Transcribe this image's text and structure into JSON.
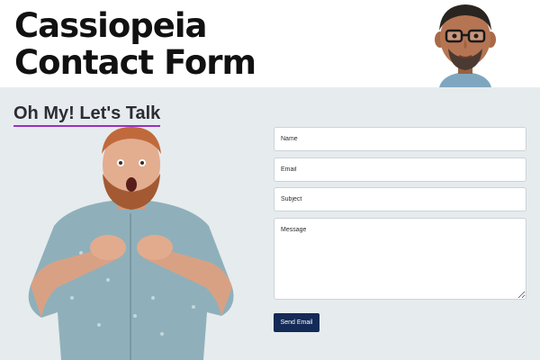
{
  "header": {
    "title": "Cassiopeia\nContact Form",
    "avatar_icon": "memoji-avatar-with-glasses"
  },
  "main": {
    "heading": "Oh My! Let's Talk",
    "heading_underline_color": "#9b2fc4",
    "illustration": "surprised-bearded-man-photo"
  },
  "form": {
    "name_placeholder": "Name",
    "email_placeholder": "Email",
    "subject_placeholder": "Subject",
    "message_placeholder": "Message",
    "submit_label": "Send Email",
    "button_color": "#142a57"
  },
  "colors": {
    "page_background": "#e6ebee",
    "header_background": "#ffffff"
  }
}
